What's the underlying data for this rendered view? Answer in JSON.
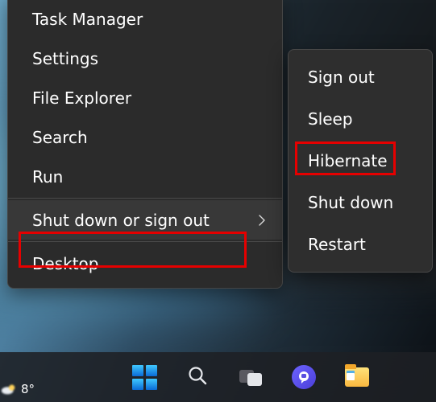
{
  "context_menu": {
    "items": [
      {
        "label": "Task Manager"
      },
      {
        "label": "Settings"
      },
      {
        "label": "File Explorer"
      },
      {
        "label": "Search"
      },
      {
        "label": "Run"
      }
    ],
    "shutdown_group": {
      "label": "Shut down or sign out",
      "highlighted": true
    },
    "desktop": {
      "label": "Desktop"
    }
  },
  "power_submenu": {
    "items": [
      {
        "label": "Sign out"
      },
      {
        "label": "Sleep"
      },
      {
        "label": "Hibernate",
        "highlighted": true
      },
      {
        "label": "Shut down"
      },
      {
        "label": "Restart"
      }
    ]
  },
  "taskbar": {
    "weather_temp": "8°",
    "icons": {
      "start": "start-icon",
      "search": "search-icon",
      "task_view": "task-view-icon",
      "chat": "chat-icon",
      "explorer": "file-explorer-icon"
    }
  }
}
